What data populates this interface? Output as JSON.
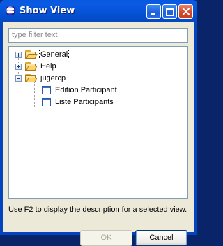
{
  "window": {
    "title": "Show View",
    "icon": "eclipse-icon"
  },
  "filter": {
    "placeholder": "type filter text",
    "value": ""
  },
  "tree": {
    "items": [
      {
        "label": "General",
        "type": "folder",
        "expanded": false,
        "selected": true
      },
      {
        "label": "Help",
        "type": "folder",
        "expanded": false,
        "selected": false
      },
      {
        "label": "jugercp",
        "type": "folder",
        "expanded": true,
        "selected": false,
        "children": [
          {
            "label": "Edition Participant",
            "type": "view"
          },
          {
            "label": "Liste Participants",
            "type": "view"
          }
        ]
      }
    ]
  },
  "description": "Use F2 to display the description for a selected view.",
  "buttons": {
    "ok_label": "OK",
    "ok_enabled": false,
    "cancel_label": "Cancel"
  }
}
